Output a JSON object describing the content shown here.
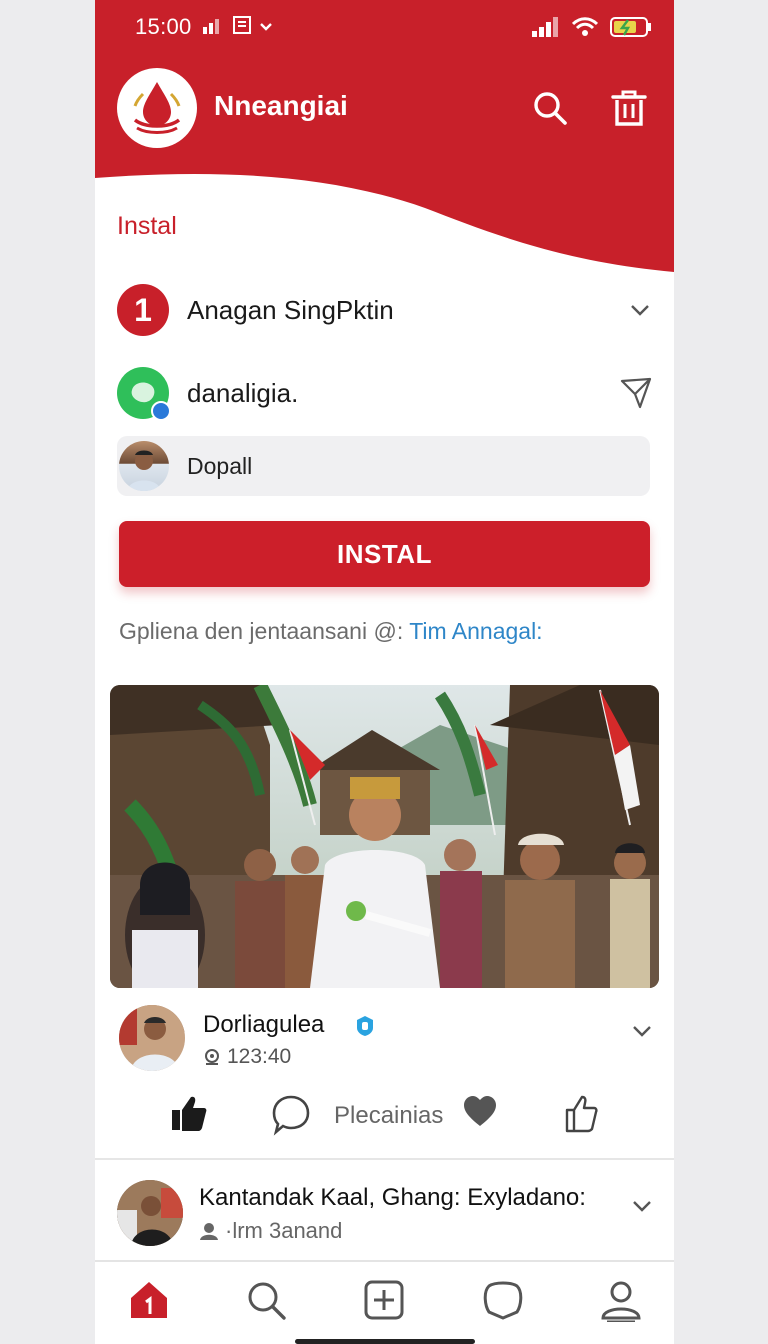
{
  "status_bar": {
    "time": "15:00"
  },
  "header": {
    "app_title": "Nneangiai"
  },
  "section": {
    "label": "Instal"
  },
  "step": {
    "number": "1",
    "title": "Anagan SingPktin"
  },
  "account": {
    "name": "danaligia."
  },
  "input": {
    "value": "Dopall"
  },
  "install_button": {
    "label": "INSTAL"
  },
  "caption": {
    "text": "Gpliena den jentaansani @: ",
    "link": "Tim Annagal:"
  },
  "post": {
    "author": "Dorliagulea",
    "time": "123:40",
    "action_label": "Plecainias"
  },
  "post2": {
    "title": "Kantandak Kaal, Ghang: Exyladano:",
    "meta": "·lrm 3anand"
  },
  "colors": {
    "brand_red": "#c8202a",
    "link_blue": "#2e86c8",
    "verified_blue": "#2a79d9",
    "green": "#2fbf5a"
  },
  "icons": {
    "header": [
      "search-icon",
      "trash-icon"
    ],
    "actions": [
      "thumbs-up-filled-icon",
      "comment-icon",
      "heart-icon",
      "thumbs-up-outline-icon"
    ],
    "nav": [
      "home-icon",
      "search-icon",
      "add-icon",
      "chat-icon",
      "profile-icon"
    ]
  }
}
